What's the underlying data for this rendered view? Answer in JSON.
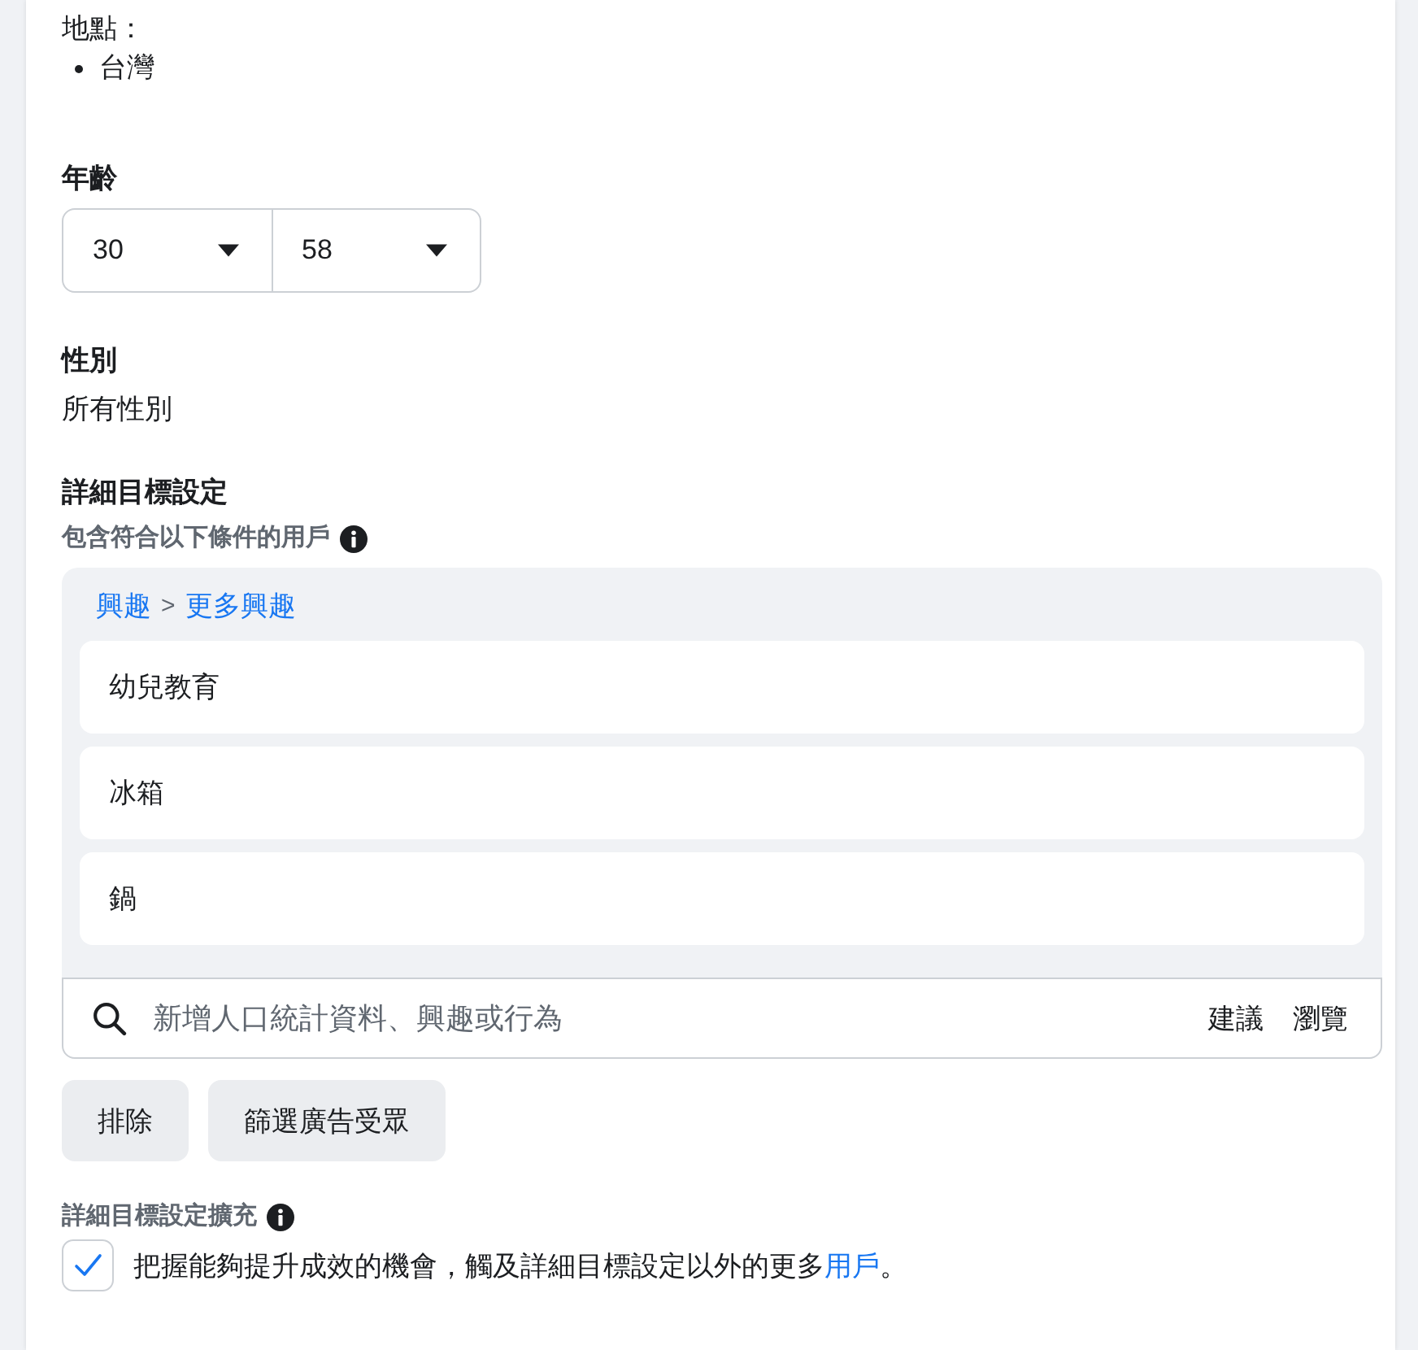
{
  "location": {
    "label": "地點：",
    "items": [
      "台灣"
    ]
  },
  "age": {
    "label": "年齡",
    "min": "30",
    "max": "58"
  },
  "gender": {
    "label": "性別",
    "value": "所有性別"
  },
  "detailed_targeting": {
    "label": "詳細目標設定",
    "hint": "包含符合以下條件的用戶",
    "breadcrumb": {
      "items": [
        "興趣",
        "更多興趣"
      ],
      "separator": ">"
    },
    "interests": [
      "幼兒教育",
      "冰箱",
      "鍋"
    ],
    "search": {
      "placeholder": "新增人口統計資料、興趣或行為",
      "actions": [
        "建議",
        "瀏覽"
      ]
    },
    "buttons": [
      "排除",
      "篩選廣告受眾"
    ]
  },
  "expansion": {
    "label": "詳細目標設定擴充",
    "checked": true,
    "text": "把握能夠提升成效的機會，觸及詳細目標設定以外的更多",
    "link": "用戶",
    "suffix": "。"
  }
}
